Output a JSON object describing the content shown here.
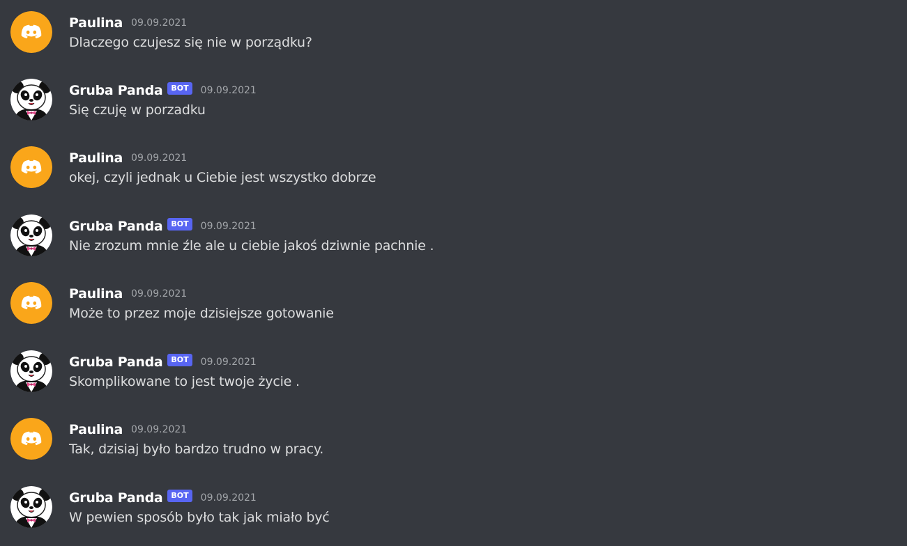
{
  "users": {
    "paulina": {
      "name": "Paulina",
      "avatar_icon": "discord-logo-icon",
      "avatar_color": "#faa61a"
    },
    "panda": {
      "name": "Gruba Panda",
      "bot_tag": "BOT",
      "avatar_icon": "panda-icon",
      "tag_color": "#5865f2"
    }
  },
  "messages": [
    {
      "author": "Paulina",
      "bot": false,
      "timestamp": "09.09.2021",
      "text": "Dlaczego czujesz się nie w porządku?"
    },
    {
      "author": "Gruba Panda",
      "bot": true,
      "bot_label": "BOT",
      "timestamp": "09.09.2021",
      "text": "Się czuję w porzadku"
    },
    {
      "author": "Paulina",
      "bot": false,
      "timestamp": "09.09.2021",
      "text": "okej, czyli jednak u Ciebie jest wszystko dobrze"
    },
    {
      "author": "Gruba Panda",
      "bot": true,
      "bot_label": "BOT",
      "timestamp": "09.09.2021",
      "text": "Nie zrozum mnie źle ale u ciebie jakoś dziwnie pachnie ."
    },
    {
      "author": "Paulina",
      "bot": false,
      "timestamp": "09.09.2021",
      "text": "Może to przez moje dzisiejsze gotowanie"
    },
    {
      "author": "Gruba Panda",
      "bot": true,
      "bot_label": "BOT",
      "timestamp": "09.09.2021",
      "text": "Skomplikowane to jest twoje życie ."
    },
    {
      "author": "Paulina",
      "bot": false,
      "timestamp": "09.09.2021",
      "text": "Tak, dzisiaj było bardzo trudno w pracy."
    },
    {
      "author": "Gruba Panda",
      "bot": true,
      "bot_label": "BOT",
      "timestamp": "09.09.2021",
      "text": "W pewien sposób było tak jak miało być"
    }
  ]
}
